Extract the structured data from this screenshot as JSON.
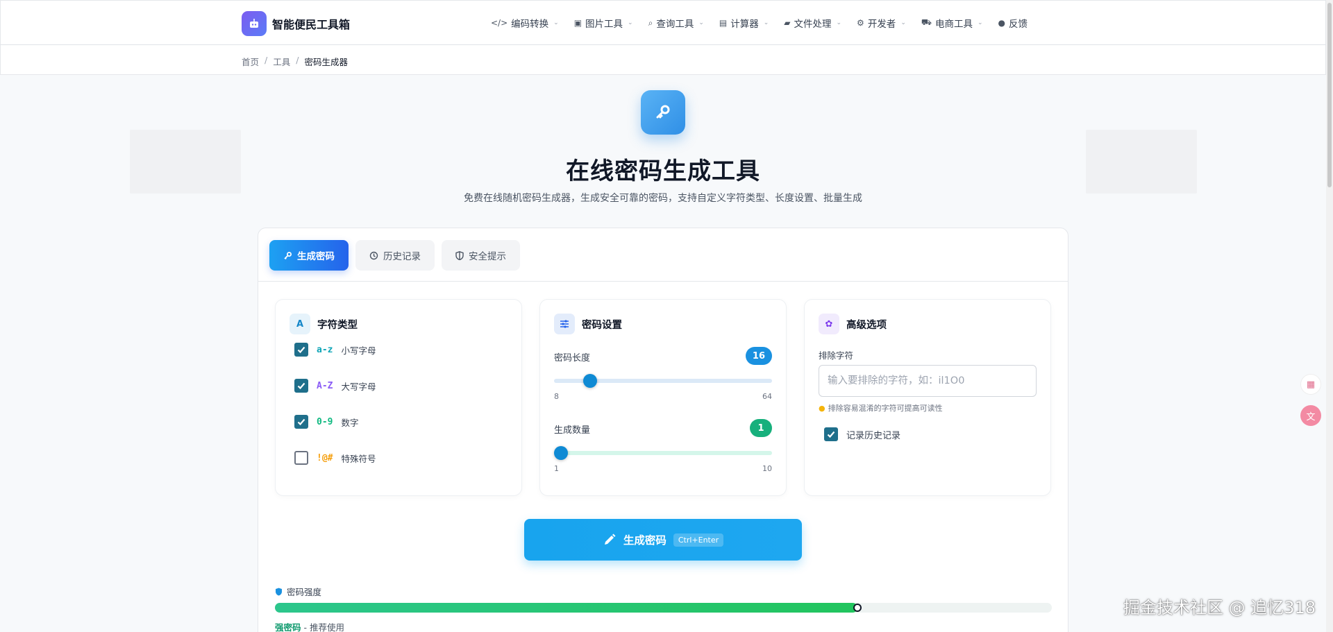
{
  "header": {
    "logo_text": "智能便民工具箱",
    "nav": [
      {
        "icon": "code-icon",
        "glyph": "</>",
        "label": "编码转换"
      },
      {
        "icon": "image-icon",
        "glyph": "▣",
        "label": "图片工具"
      },
      {
        "icon": "search-icon",
        "glyph": "⌕",
        "label": "查询工具"
      },
      {
        "icon": "calculator-icon",
        "glyph": "▤",
        "label": "计算器"
      },
      {
        "icon": "folder-icon",
        "glyph": "▰",
        "label": "文件处理"
      },
      {
        "icon": "gear-icon",
        "glyph": "⚙",
        "label": "开发者"
      },
      {
        "icon": "cart-icon",
        "glyph": "⛟",
        "label": "电商工具"
      }
    ],
    "feedback_label": "反馈"
  },
  "breadcrumb": {
    "home": "首页",
    "tools": "工具",
    "current": "密码生成器",
    "sep": "/"
  },
  "hero": {
    "title": "在线密码生成工具",
    "subtitle": "免费在线随机密码生成器，生成安全可靠的密码，支持自定义字符类型、长度设置、批量生成"
  },
  "tabs": [
    {
      "label": "生成密码",
      "icon": "key-icon",
      "active": true
    },
    {
      "label": "历史记录",
      "icon": "history-icon",
      "active": false
    },
    {
      "label": "安全提示",
      "icon": "shield-icon",
      "active": false
    }
  ],
  "char_types": {
    "title": "字符类型",
    "icon_glyph": "A",
    "options": [
      {
        "code": "a-z",
        "label": "小写字母",
        "checked": true,
        "color": "#0ea5b7"
      },
      {
        "code": "A-Z",
        "label": "大写字母",
        "checked": true,
        "color": "#8b5cf6"
      },
      {
        "code": "0-9",
        "label": "数字",
        "checked": true,
        "color": "#10b981"
      },
      {
        "code": "!@#",
        "label": "特殊符号",
        "checked": false,
        "color": "#f59e0b"
      }
    ]
  },
  "settings": {
    "title": "密码设置",
    "length": {
      "label": "密码长度",
      "value": "16",
      "min": "8",
      "max": "64"
    },
    "count": {
      "label": "生成数量",
      "value": "1",
      "min": "1",
      "max": "10"
    }
  },
  "advanced": {
    "title": "高级选项",
    "exclude_label": "排除字符",
    "exclude_value": "",
    "exclude_placeholder": "输入要排除的字符，如：il1O0",
    "hint": "排除容易混淆的字符可提高可读性",
    "record_history_label": "记录历史记录",
    "record_history_checked": true
  },
  "generate": {
    "label": "生成密码",
    "shortcut": "Ctrl+Enter"
  },
  "strength": {
    "label": "密码强度",
    "level": "强密码",
    "desc": " - 推荐使用",
    "fraction": 0.75
  },
  "colors": {
    "accent": "#1da1f2",
    "checkbox": "#1f6f8b",
    "strength": "#22c55e"
  },
  "watermark": "掘金技术社区 @ 追忆318"
}
